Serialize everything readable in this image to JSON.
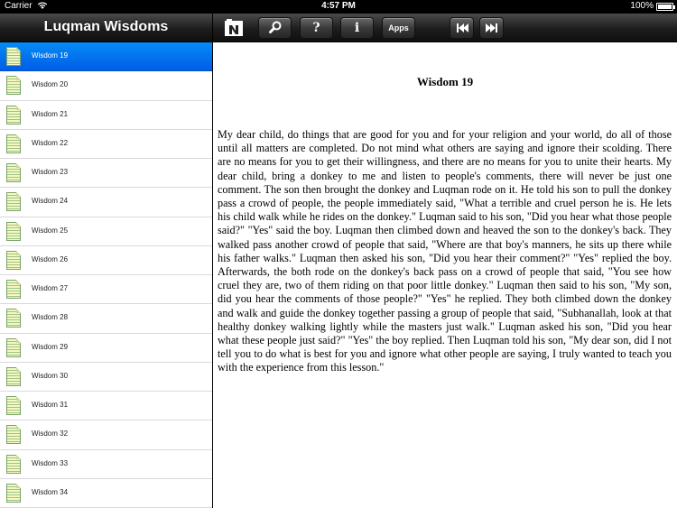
{
  "status_bar": {
    "carrier": "Carrier",
    "wifi_icon": "wifi-icon",
    "time": "4:57 PM",
    "battery": "100%"
  },
  "sidebar": {
    "title": "Luqman Wisdoms",
    "items": [
      {
        "label": "Wisdom 19",
        "selected": true
      },
      {
        "label": "Wisdom 20"
      },
      {
        "label": "Wisdom 21"
      },
      {
        "label": "Wisdom 22"
      },
      {
        "label": "Wisdom 23"
      },
      {
        "label": "Wisdom 24"
      },
      {
        "label": "Wisdom 25"
      },
      {
        "label": "Wisdom 26"
      },
      {
        "label": "Wisdom 27"
      },
      {
        "label": "Wisdom 28"
      },
      {
        "label": "Wisdom 29"
      },
      {
        "label": "Wisdom 30"
      },
      {
        "label": "Wisdom 31"
      },
      {
        "label": "Wisdom 32"
      },
      {
        "label": "Wisdom 33"
      },
      {
        "label": "Wisdom 34"
      }
    ]
  },
  "toolbar": {
    "logo_icon": "book-logo-icon",
    "search_icon": "search-icon",
    "help_label": "?",
    "info_label": "i",
    "apps_label": "Apps",
    "prev_icon": "skip-back-icon",
    "next_icon": "skip-forward-icon"
  },
  "content": {
    "title": "Wisdom 19",
    "body": "My dear child, do things that are good for you and for your religion and your world, do all of those until all matters are completed. Do not mind what others are saying and ignore their scolding. There are no means for you to get their willingness, and there are no means for you to unite their hearts. My dear child, bring a donkey to me and listen to people's comments, there will never be just one comment. The son then brought the donkey and Luqman rode on it. He told his son to pull the donkey pass a crowd of people, the people immediately said, \"What a terrible and cruel person he is. He lets his child walk while he rides on the donkey.\" Luqman said to his son, \"Did you hear what those people said?\" \"Yes\" said the boy. Luqman then climbed down and heaved the son to the donkey's back. They walked pass another crowd of people that said, \"Where are that boy's manners, he sits up there while his father walks.\" Luqman then asked his son, \"Did you hear their comment?\" \"Yes\" replied the boy. Afterwards, the both rode on the donkey's back pass on a crowd of people that said, \"You see how cruel they are, two of them riding on that poor little donkey.\" Luqman then said to his son, \"My son, did you hear the comments of those people?\" \"Yes\" he replied. They both climbed down the donkey and walk and guide the donkey together passing a group of people that said, \"Subhanallah, look at that healthy donkey walking lightly while the masters just walk.\" Luqman asked his son, \"Did you hear what these people just said?\" \"Yes\" the boy replied. Then Luqman told his son, \"My dear son, did I not tell you to do what is best for you and ignore what other people are saying, I truly wanted to teach you with the experience from this lesson.\""
  }
}
